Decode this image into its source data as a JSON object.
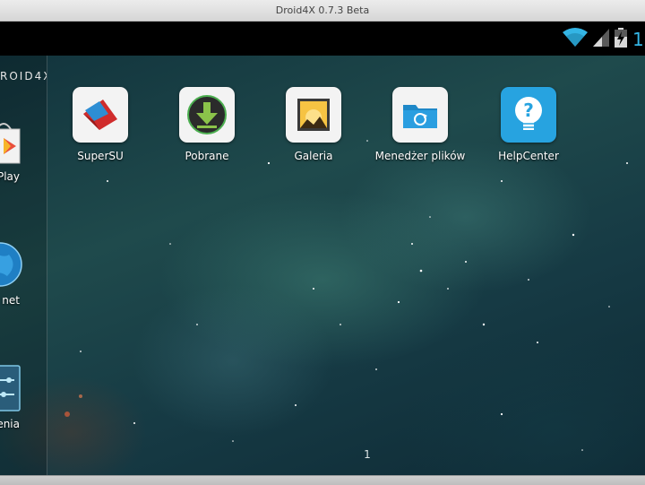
{
  "window": {
    "title": "Droid4X 0.7.3 Beta"
  },
  "status_bar": {
    "clock_partial": "1(",
    "icons": [
      "wifi-icon",
      "signal-icon",
      "battery-icon"
    ]
  },
  "dock": {
    "brand": "ROID4X",
    "items": [
      {
        "label": "Play",
        "icon": "play-store-icon"
      },
      {
        "label": "net",
        "icon": "internet-globe-icon"
      },
      {
        "label": "enia",
        "icon": "settings-icon"
      }
    ]
  },
  "apps": [
    {
      "label": "SuperSU",
      "icon": "supersu-icon"
    },
    {
      "label": "Pobrane",
      "icon": "download-icon"
    },
    {
      "label": "Galeria",
      "icon": "gallery-icon"
    },
    {
      "label": "Menedżer plików",
      "icon": "file-manager-icon"
    },
    {
      "label": "HelpCenter",
      "icon": "help-center-icon"
    }
  ],
  "page_indicator": "1",
  "colors": {
    "accent_blue": "#34b5e5",
    "status_bar": "#000000",
    "title_bar": "#e0e0e0"
  }
}
